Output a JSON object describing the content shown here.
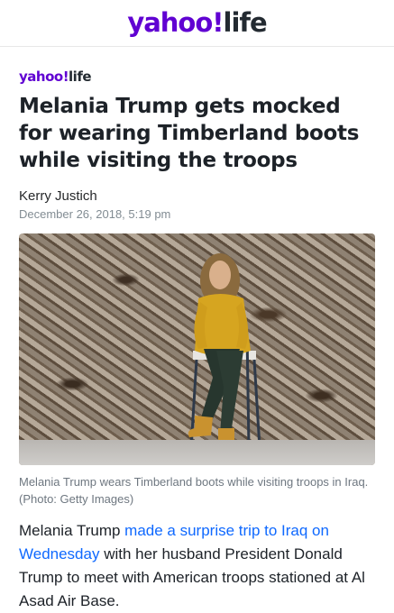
{
  "header": {
    "logo_brand": "yahoo!",
    "logo_section": "life"
  },
  "article": {
    "section_brand": "yahoo!",
    "section_name": "life",
    "headline": "Melania Trump gets mocked for wearing Timberland boots while visiting the troops",
    "author": "Kerry Justich",
    "date": "December 26, 2018, 5:19 pm",
    "image_caption": "Melania Trump wears Timberland boots while visiting troops in Iraq. (Photo: Getty Images)",
    "body": {
      "text_1": "Melania Trump ",
      "link_1": "made a surprise trip to Iraq on Wednesday",
      "text_2": " with her husband President Donald Trump to meet with American troops stationed at Al Asad Air Base."
    }
  },
  "colors": {
    "brand_purple": "#6001d2",
    "link_blue": "#0f69ff",
    "text_dark": "#1d2228",
    "text_gray": "#828c93"
  }
}
